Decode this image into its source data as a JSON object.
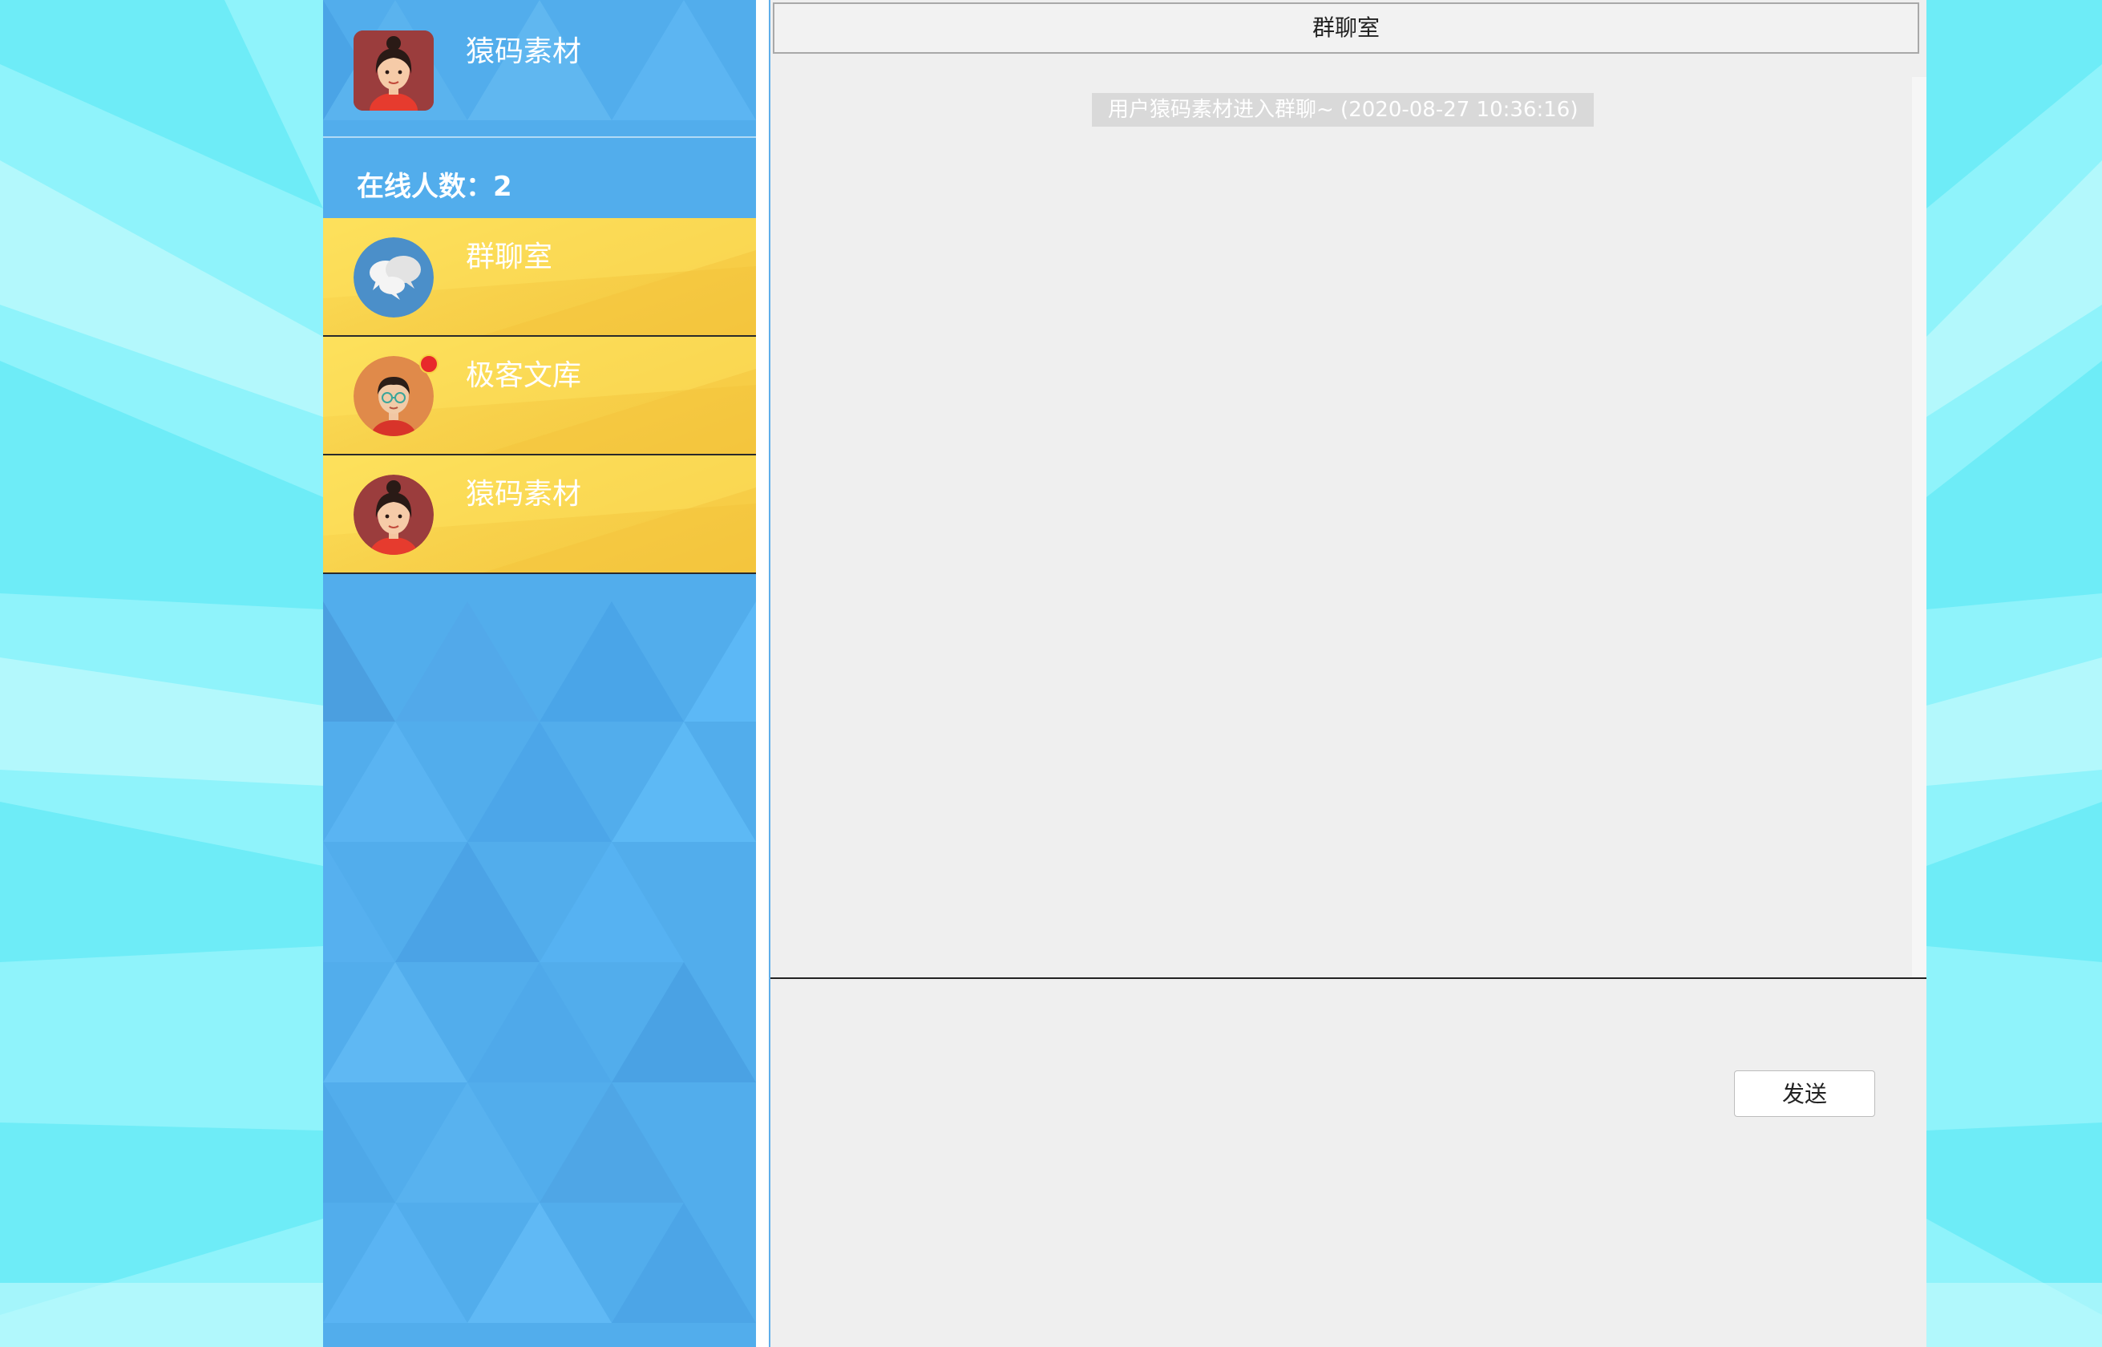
{
  "me": {
    "name": "猿码素材",
    "avatar_icon": "woman-avatar-icon"
  },
  "online": {
    "label": "在线人数：2"
  },
  "contacts": [
    {
      "name": "群聊室",
      "avatar_icon": "chat-bubbles-icon"
    },
    {
      "name": "极客文库",
      "avatar_icon": "man-glasses-avatar-icon",
      "unread": true
    },
    {
      "name": "猿码素材",
      "avatar_icon": "woman-avatar-icon"
    }
  ],
  "chat": {
    "title": "群聊室",
    "messages": [
      {
        "type": "system",
        "text": "用户猿码素材进入群聊~ (2020-08-27 10:36:16)"
      }
    ],
    "send_label": "发送"
  },
  "colors": {
    "sidebar_blue": "#52adec",
    "contact_yellow": "#f8d24c",
    "page_cyan": "#8ff3fb",
    "unread_red": "#e8282b"
  }
}
